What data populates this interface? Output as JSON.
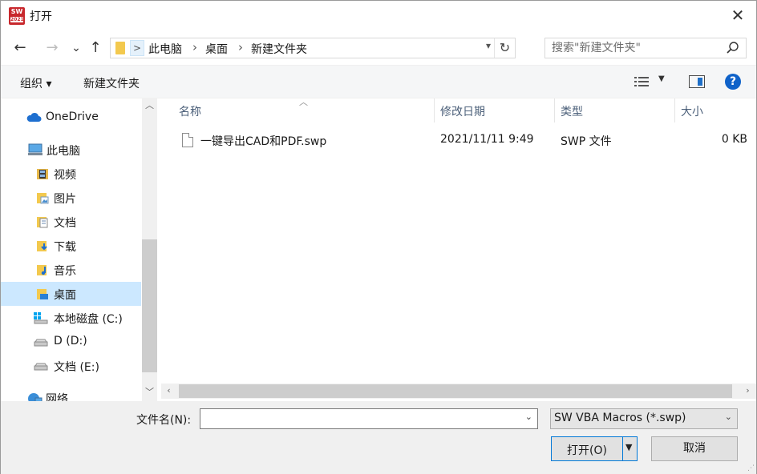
{
  "window": {
    "title": "打开",
    "app_icon_text": "SW",
    "app_icon_year": "2021",
    "close_symbol": "✕"
  },
  "nav": {
    "back_symbol": "←",
    "forward_symbol": "→",
    "recent_symbol": "⌄",
    "up_symbol": "↑",
    "breadcrumb": [
      "此电脑",
      "桌面",
      "新建文件夹"
    ],
    "refresh_symbol": "↻",
    "search_placeholder": "搜索\"新建文件夹\""
  },
  "toolbar": {
    "organize_label": "组织 ▾",
    "new_folder_label": "新建文件夹",
    "help_label": "?"
  },
  "sidebar": {
    "items": [
      {
        "label": "OneDrive",
        "icon": "cloud-icon"
      },
      {
        "label": "此电脑",
        "icon": "computer-icon"
      },
      {
        "label": "视频",
        "icon": "video-folder-icon"
      },
      {
        "label": "图片",
        "icon": "pictures-folder-icon"
      },
      {
        "label": "文档",
        "icon": "documents-folder-icon"
      },
      {
        "label": "下载",
        "icon": "downloads-folder-icon"
      },
      {
        "label": "音乐",
        "icon": "music-folder-icon"
      },
      {
        "label": "桌面",
        "icon": "desktop-folder-icon",
        "selected": true
      },
      {
        "label": "本地磁盘 (C:)",
        "icon": "drive-c-icon"
      },
      {
        "label": "D (D:)",
        "icon": "drive-icon"
      },
      {
        "label": "文档 (E:)",
        "icon": "drive-icon"
      },
      {
        "label": "网络",
        "icon": "network-icon"
      }
    ]
  },
  "file_list": {
    "columns": [
      "名称",
      "修改日期",
      "类型",
      "大小"
    ],
    "rows": [
      {
        "name": "一键导出CAD和PDF.swp",
        "modified": "2021/11/11 9:49",
        "type": "SWP 文件",
        "size": "0 KB"
      }
    ]
  },
  "footer": {
    "filename_label": "文件名(N):",
    "filename_value": "",
    "filter_value": "SW VBA Macros (*.swp)",
    "open_label": "打开(O)",
    "cancel_label": "取消"
  },
  "colors": {
    "accent": "#0078d7",
    "selection": "#cce8ff",
    "folder": "#f3c94e"
  }
}
